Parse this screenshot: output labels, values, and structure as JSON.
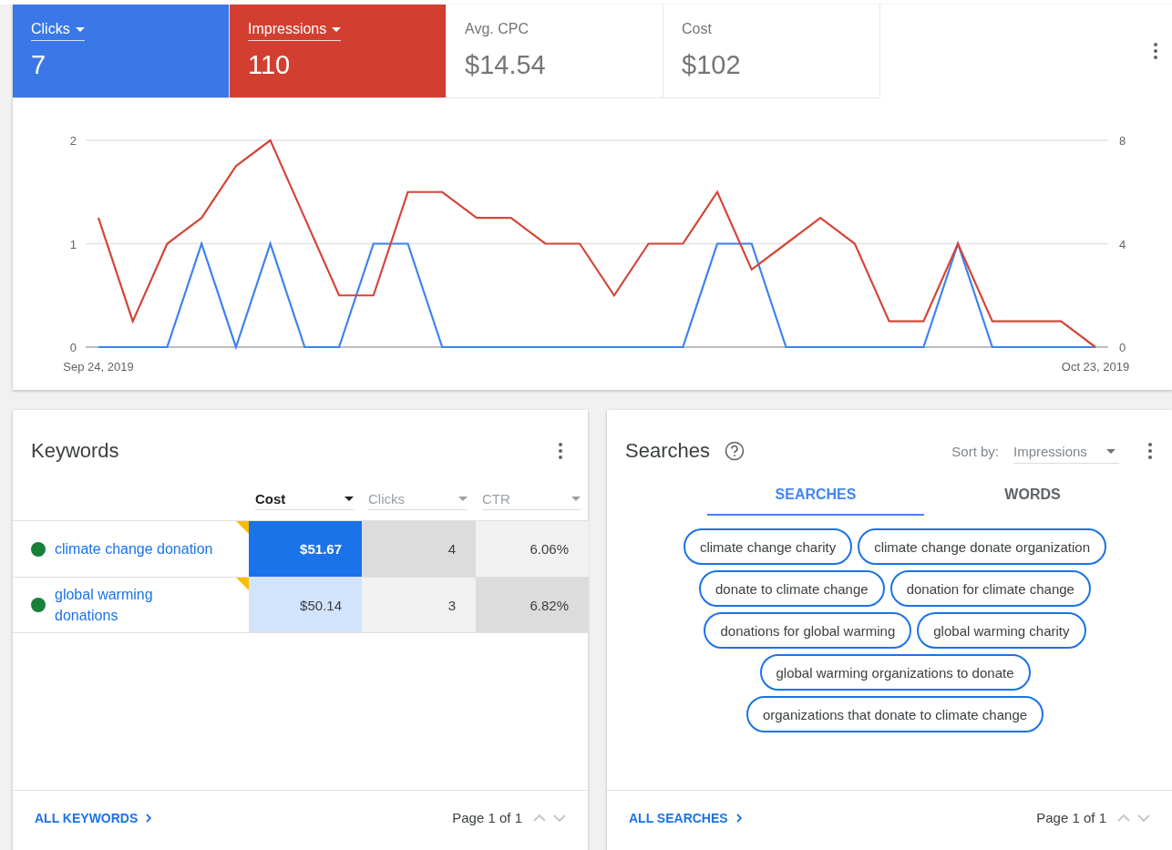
{
  "metrics": [
    {
      "label": "Clicks",
      "value": "7",
      "selected": true,
      "color": "#3b78e7"
    },
    {
      "label": "Impressions",
      "value": "110",
      "selected": true,
      "color": "#d23f31"
    },
    {
      "label": "Avg. CPC",
      "value": "$14.54",
      "selected": false
    },
    {
      "label": "Cost",
      "value": "$102",
      "selected": false
    }
  ],
  "chart": {
    "chart_data": {
      "type": "line",
      "categories": [
        "Sep 24, 2019",
        null,
        null,
        null,
        null,
        null,
        null,
        null,
        null,
        null,
        null,
        null,
        null,
        null,
        null,
        null,
        null,
        null,
        null,
        null,
        null,
        null,
        null,
        null,
        null,
        null,
        null,
        null,
        null,
        "Oct 23, 2019"
      ],
      "ylim": [
        0,
        2
      ],
      "yticks": [
        0,
        1,
        2
      ],
      "y2lim": [
        0,
        8
      ],
      "y2ticks": [
        0,
        4,
        8
      ],
      "series": [
        {
          "color": "#3b82f0",
          "values": [
            0,
            0,
            0,
            1,
            0,
            1,
            0,
            0,
            1,
            1,
            0,
            0,
            0,
            0,
            0,
            0,
            0,
            0,
            1,
            1,
            0,
            0,
            0,
            0,
            0,
            1,
            0,
            0,
            0,
            0
          ]
        },
        {
          "color": "#d44638",
          "axis": "y2",
          "values": [
            5,
            1,
            4,
            5,
            7,
            8,
            5,
            2,
            2,
            6,
            6,
            5,
            5,
            4,
            4,
            2,
            4,
            4,
            6,
            3,
            4,
            5,
            4,
            1,
            1,
            4,
            1,
            1,
            1,
            0
          ]
        }
      ]
    }
  },
  "keywords": {
    "title": "Keywords",
    "columns": [
      {
        "label": "Cost",
        "sorted": true
      },
      {
        "label": "Clicks",
        "sorted": false
      },
      {
        "label": "CTR",
        "sorted": false
      }
    ],
    "rows": [
      {
        "keyword": "climate change donation",
        "color": "#188038",
        "flagged": true,
        "cells": [
          {
            "value": "$51.67",
            "color": "#1a73e8"
          },
          {
            "value": "4",
            "color": "#dcdcdc"
          },
          {
            "value": "6.06%",
            "color": "#f1f1f1"
          }
        ]
      },
      {
        "keyword": "global warming donations",
        "color": "#188038",
        "flagged": true,
        "cells": [
          {
            "value": "$50.14",
            "color": "#d2e3fc"
          },
          {
            "value": "3",
            "color": "#f1f1f1"
          },
          {
            "value": "6.82%",
            "color": "#dcdcdc"
          }
        ]
      }
    ],
    "footer_link": "ALL KEYWORDS",
    "pagination": "Page 1 of 1"
  },
  "searches": {
    "title": "Searches",
    "sort_label": "Sort by:",
    "sort_value": "Impressions",
    "tabs": [
      {
        "label": "SEARCHES",
        "selected": true
      },
      {
        "label": "WORDS",
        "selected": false
      }
    ],
    "chips": [
      [
        "climate change charity",
        "climate change donate organization"
      ],
      [
        "donate to climate change",
        "donation for climate change"
      ],
      [
        "donations for global warming",
        "global warming charity"
      ],
      [
        "global warming organizations to donate"
      ],
      [
        "organizations that donate to climate change"
      ]
    ],
    "footer_link": "ALL SEARCHES",
    "pagination": "Page 1 of 1"
  }
}
